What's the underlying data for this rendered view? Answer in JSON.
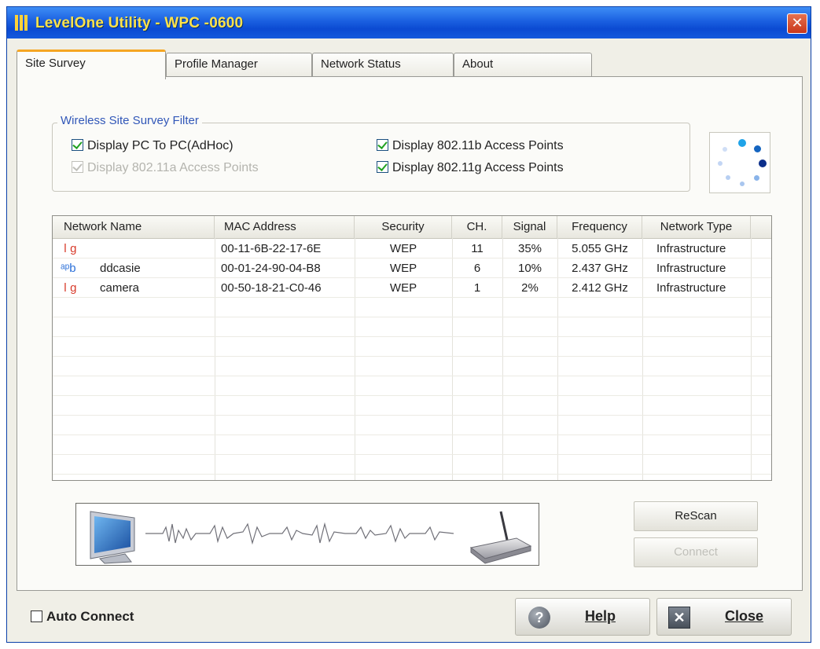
{
  "window": {
    "title": "LevelOne Utility - WPC -0600",
    "close_glyph": "✕"
  },
  "tabs": [
    {
      "label": "Site Survey",
      "active": true
    },
    {
      "label": "Profile Manager",
      "active": false
    },
    {
      "label": "Network Status",
      "active": false
    },
    {
      "label": "About",
      "active": false
    }
  ],
  "filter": {
    "legend": "Wireless Site Survey Filter",
    "options": [
      {
        "label": "Display PC To PC(AdHoc)",
        "checked": true,
        "enabled": true
      },
      {
        "label": "Display 802.11a Access Points",
        "checked": true,
        "enabled": false
      },
      {
        "label": "Display 802.11b Access Points",
        "checked": true,
        "enabled": true
      },
      {
        "label": "Display 802.11g Access Points",
        "checked": true,
        "enabled": true
      }
    ]
  },
  "list": {
    "columns": [
      "Network Name",
      "MAC Address",
      "Security",
      "CH.",
      "Signal",
      "Frequency",
      "Network Type"
    ],
    "rows": [
      {
        "icon": "g",
        "name": "",
        "mac": "00-11-6B-22-17-6E",
        "security": "WEP",
        "ch": "11",
        "signal": "35%",
        "frequency": "5.055 GHz",
        "type": "Infrastructure"
      },
      {
        "icon": "b",
        "name": "ddcasie",
        "mac": "00-01-24-90-04-B8",
        "security": "WEP",
        "ch": "6",
        "signal": "10%",
        "frequency": "2.437 GHz",
        "type": "Infrastructure"
      },
      {
        "icon": "g",
        "name": "camera",
        "mac": "00-50-18-21-C0-46",
        "security": "WEP",
        "ch": "1",
        "signal": "2%",
        "frequency": "2.412 GHz",
        "type": "Infrastructure"
      }
    ]
  },
  "buttons": {
    "rescan": "ReScan",
    "connect": "Connect",
    "help": "Help",
    "close": "Close",
    "help_icon": "?",
    "close_icon": "✕"
  },
  "auto_connect": {
    "label": "Auto Connect",
    "checked": false
  },
  "colors": {
    "title_bar": "#0b4ad2",
    "title_text": "#ffe24a",
    "tab_accent": "#f5a623",
    "legend_text": "#3157b8",
    "check_green": "#21a121"
  }
}
